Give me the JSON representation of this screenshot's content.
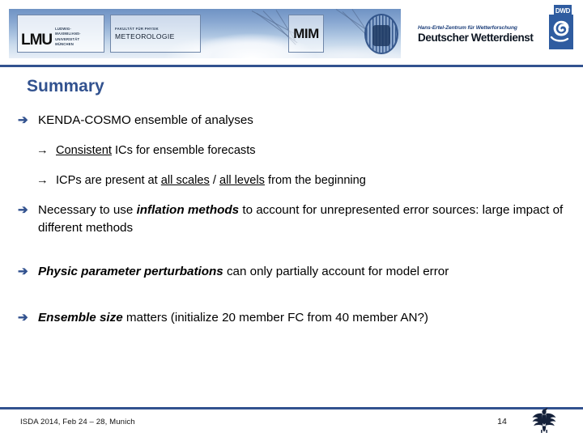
{
  "header": {
    "banner_alt": "cloud-photo-banner",
    "lmu_logo": {
      "mark": "LMU",
      "line1": "LUDWIG-",
      "line2": "MAXIMILIANS-",
      "line3": "UNIVERSITÄT",
      "line4": "MÜNCHEN"
    },
    "meteorology_logo": {
      "faculty": "FAKULTÄT FÜR PHYSIK",
      "name": "METEOROLOGIE"
    },
    "mim_logo": {
      "mark": "MIM"
    },
    "seal_alt": "lmu-university-seal",
    "dwd_wordmark": {
      "line1": "Hans-Ertel-Zentrum für Wetterforschung",
      "line2": "Deutscher Wetterdienst"
    },
    "dwd_logo": {
      "mark": "DWD"
    }
  },
  "slide": {
    "title": "Summary",
    "bullets": [
      {
        "marker": "➔",
        "level": 1,
        "parts": [
          {
            "text": "KENDA-COSMO ensemble of analyses",
            "style": "normal"
          }
        ]
      },
      {
        "marker": "→",
        "level": 2,
        "parts": [
          {
            "text": "Consistent",
            "style": "underline"
          },
          {
            "text": " ICs for ensemble forecasts",
            "style": "normal"
          }
        ]
      },
      {
        "marker": "→",
        "level": 2,
        "parts": [
          {
            "text": "ICPs are present at ",
            "style": "normal"
          },
          {
            "text": "all scales",
            "style": "underline"
          },
          {
            "text": " / ",
            "style": "normal"
          },
          {
            "text": "all levels",
            "style": "underline"
          },
          {
            "text": " from the beginning",
            "style": "normal"
          }
        ]
      },
      {
        "marker": "➔",
        "level": 1,
        "parts": [
          {
            "text": "Necessary to use ",
            "style": "normal"
          },
          {
            "text": "inflation methods",
            "style": "bold-italic"
          },
          {
            "text": " to account for unrepresented error sources: large impact of different methods",
            "style": "normal"
          }
        ]
      },
      {
        "marker": "➔",
        "level": 1,
        "parts": [
          {
            "text": "Physic parameter perturbations",
            "style": "bold-italic"
          },
          {
            "text": " can only partially account for model error",
            "style": "normal"
          }
        ]
      },
      {
        "marker": "➔",
        "level": 1,
        "parts": [
          {
            "text": "Ensemble size",
            "style": "bold-italic"
          },
          {
            "text": " matters (initialize 20 member FC from 40 member AN?)",
            "style": "normal"
          }
        ]
      }
    ]
  },
  "footer": {
    "conference": "ISDA 2014, Feb 24 – 28, Munich",
    "page_number": "14",
    "emblem_alt": "german-federal-eagle"
  },
  "colors": {
    "accent_blue": "#32528f",
    "title_blue": "#32528f",
    "text_black": "#000000"
  }
}
